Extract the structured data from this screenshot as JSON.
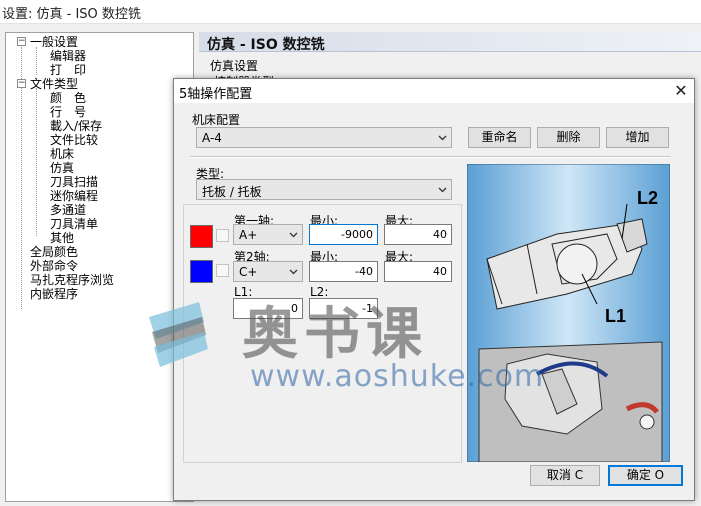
{
  "window": {
    "title": "设置: 仿真 - ISO 数控铣"
  },
  "tree": {
    "items": [
      {
        "label": "一般设置"
      },
      {
        "label": "编辑器"
      },
      {
        "label": "打　印"
      },
      {
        "label": "文件类型"
      },
      {
        "label": "颜　色"
      },
      {
        "label": "行　号"
      },
      {
        "label": "載入/保存"
      },
      {
        "label": "文件比较"
      },
      {
        "label": "机床"
      },
      {
        "label": "仿真"
      },
      {
        "label": "刀具扫描"
      },
      {
        "label": "迷你编程"
      },
      {
        "label": "多通道"
      },
      {
        "label": "刀具清单"
      },
      {
        "label": "其他"
      },
      {
        "label": "全局颜色"
      },
      {
        "label": "外部命令"
      },
      {
        "label": "马扎克程序浏览"
      },
      {
        "label": "内嵌程序"
      }
    ]
  },
  "panel": {
    "header": "仿真 - ISO 数控铣",
    "section": "仿真设置",
    "field_partial": "控制器类型"
  },
  "dialog": {
    "title": "5轴操作配置",
    "machine_config_label": "机床配置",
    "machine_config_value": "A-4",
    "rename_button": "重命名",
    "delete_button": "删除",
    "add_button": "增加",
    "type_label": "类型:",
    "type_value": "托板 / 托板",
    "axis1": {
      "label": "第一轴:",
      "value": "A+",
      "min_label": "最小:",
      "min": "-9000",
      "max_label": "最大:",
      "max": "40",
      "color": "#ff0000"
    },
    "axis2": {
      "label": "第2轴:",
      "value": "C+",
      "min_label": "最小:",
      "min": "-40",
      "max_label": "最大:",
      "max": "40",
      "color": "#0000ff"
    },
    "l1_label": "L1:",
    "l1": "0",
    "l2_label": "L2:",
    "l2": "-1",
    "image_labels": {
      "l1": "L1",
      "l2": "L2"
    },
    "cancel_button": "取消 C",
    "ok_button": "确定 O"
  },
  "watermark": {
    "chars": "奥书课",
    "url": "www.aoshuke.com"
  }
}
